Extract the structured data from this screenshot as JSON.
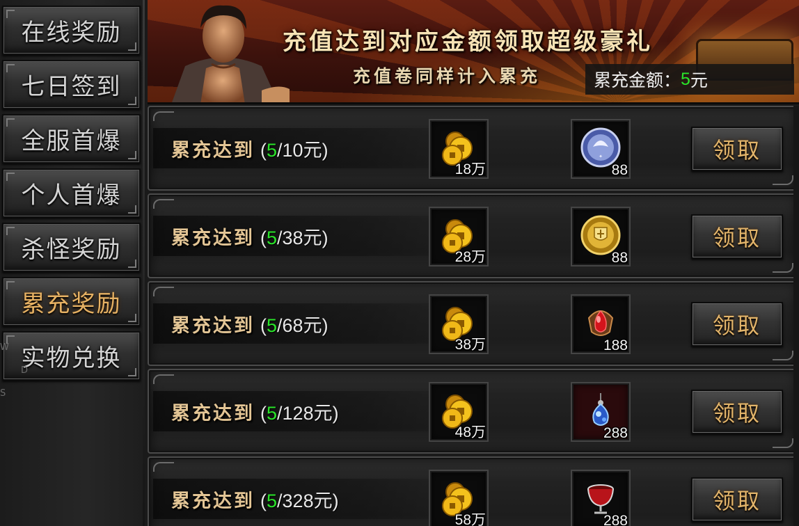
{
  "sidebar": {
    "items": [
      {
        "label": "在线奖励",
        "active": false
      },
      {
        "label": "七日签到",
        "active": false
      },
      {
        "label": "全服首爆",
        "active": false
      },
      {
        "label": "个人首爆",
        "active": false
      },
      {
        "label": "杀怪奖励",
        "active": false
      },
      {
        "label": "累充奖励",
        "active": true
      },
      {
        "label": "实物兑换",
        "active": false
      }
    ],
    "ghost": {
      "w": "W",
      "d": "D",
      "s": "S"
    }
  },
  "banner": {
    "title": "充值达到对应金额领取超级豪礼",
    "subtitle": "充值卷同样计入累充",
    "cumulative_label": "累充金额：",
    "cumulative_value": "5",
    "cumulative_unit": "元"
  },
  "colors": {
    "progress_green": "#2ae62a",
    "gold_text": "#e3c595",
    "active_tab": "#e6b163"
  },
  "rewards": [
    {
      "label": "累充达到",
      "open": " (",
      "current": "5",
      "target": "/10元)",
      "item1": {
        "icon": "gold-coins-icon",
        "qty": "18万"
      },
      "item2": {
        "icon": "silver-medal-icon",
        "qty": "88"
      },
      "button": "领取"
    },
    {
      "label": "累充达到",
      "open": " (",
      "current": "5",
      "target": "/38元)",
      "item1": {
        "icon": "gold-coins-icon",
        "qty": "28万"
      },
      "item2": {
        "icon": "gold-medal-icon",
        "qty": "88"
      },
      "button": "领取"
    },
    {
      "label": "累充达到",
      "open": " (",
      "current": "5",
      "target": "/68元)",
      "item1": {
        "icon": "gold-coins-icon",
        "qty": "38万"
      },
      "item2": {
        "icon": "red-gem-icon",
        "qty": "188"
      },
      "button": "领取"
    },
    {
      "label": "累充达到",
      "open": " (",
      "current": "5",
      "target": "/128元)",
      "item1": {
        "icon": "gold-coins-icon",
        "qty": "48万"
      },
      "item2": {
        "icon": "blue-crystal-pendant-icon",
        "qty": "288"
      },
      "button": "领取"
    },
    {
      "label": "累充达到",
      "open": " (",
      "current": "5",
      "target": "/328元)",
      "item1": {
        "icon": "gold-coins-icon",
        "qty": "58万"
      },
      "item2": {
        "icon": "red-cup-icon",
        "qty": "288"
      },
      "button": "领取"
    }
  ]
}
